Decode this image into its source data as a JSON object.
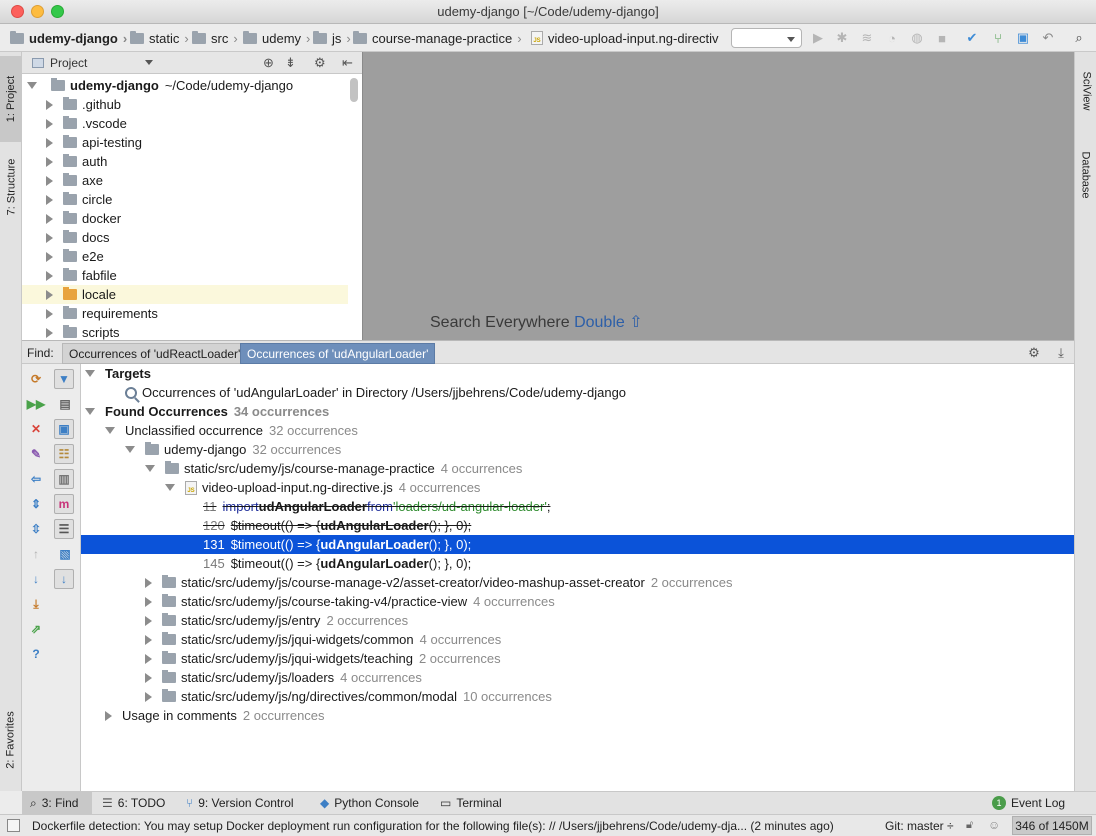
{
  "window": {
    "title": "udemy-django [~/Code/udemy-django]"
  },
  "breadcrumbs": [
    {
      "label": "udemy-django"
    },
    {
      "label": "static"
    },
    {
      "label": "src"
    },
    {
      "label": "udemy"
    },
    {
      "label": "js"
    },
    {
      "label": "course-manage-practice"
    },
    {
      "label": "video-upload-input.ng-directiv"
    }
  ],
  "left_strip": {
    "project_tab": "1: Project",
    "structure_tab": "7: Structure",
    "favorites_tab": "2: Favorites"
  },
  "right_strip": {
    "sciview_tab": "SciView",
    "database_tab": "Database"
  },
  "project_panel": {
    "header_label": "Project",
    "root": {
      "name": "udemy-django",
      "path": "~/Code/udemy-django"
    },
    "items": [
      ".github",
      ".vscode",
      "api-testing",
      "auth",
      "axe",
      "circle",
      "docker",
      "docs",
      "e2e",
      "fabfile",
      "locale",
      "requirements",
      "scripts"
    ]
  },
  "editor": {
    "hint_text": "Search Everywhere",
    "hint_key": "Double ⇧"
  },
  "find": {
    "label": "Find:",
    "tabs": [
      {
        "label": "Occurrences of 'udReactLoader'"
      },
      {
        "label": "Occurrences of 'udAngularLoader'"
      }
    ],
    "targets_label": "Targets",
    "target_text": "Occurrences of 'udAngularLoader' in Directory /Users/jjbehrens/Code/udemy-django",
    "found_label": "Found Occurrences",
    "found_count": "34 occurrences",
    "unclassified_label": "Unclassified occurrence",
    "unclassified_count": "32 occurrences",
    "project_label": "udemy-django",
    "project_count": "32 occurrences",
    "dir_practice": "static/src/udemy/js/course-manage-practice",
    "dir_practice_count": "4 occurrences",
    "file_label": "video-upload-input.ng-directive.js",
    "file_count": "4 occurrences",
    "lines": [
      {
        "num": "11",
        "pre": "import ",
        "ident": "udAngularLoader",
        "mid": " from ",
        "str": "'loaders/ud-angular-loader'",
        "post": ";"
      },
      {
        "num": "120",
        "pre": "$timeout(() => { ",
        "ident": "udAngularLoader",
        "post": "(); }, 0);"
      },
      {
        "num": "131",
        "pre": "$timeout(() => { ",
        "ident": "udAngularLoader",
        "post": "(); }, 0);"
      },
      {
        "num": "145",
        "pre": "$timeout(() => { ",
        "ident": "udAngularLoader",
        "post": "(); }, 0);"
      }
    ],
    "other_dirs": [
      {
        "path": "static/src/udemy/js/course-manage-v2/asset-creator/video-mashup-asset-creator",
        "count": "2 occurrences"
      },
      {
        "path": "static/src/udemy/js/course-taking-v4/practice-view",
        "count": "4 occurrences"
      },
      {
        "path": "static/src/udemy/js/entry",
        "count": "2 occurrences"
      },
      {
        "path": "static/src/udemy/js/jqui-widgets/common",
        "count": "4 occurrences"
      },
      {
        "path": "static/src/udemy/js/jqui-widgets/teaching",
        "count": "2 occurrences"
      },
      {
        "path": "static/src/udemy/js/loaders",
        "count": "4 occurrences"
      },
      {
        "path": "static/src/udemy/js/ng/directives/common/modal",
        "count": "10 occurrences"
      }
    ],
    "comments_label": "Usage in comments",
    "comments_count": "2 occurrences"
  },
  "bottom_tabs": [
    {
      "label": "3: Find",
      "icon": "search-icon"
    },
    {
      "label": "6: TODO",
      "icon": "todo-icon"
    },
    {
      "label": "9: Version Control",
      "icon": "vcs-icon"
    },
    {
      "label": "Python Console",
      "icon": "python-icon"
    },
    {
      "label": "Terminal",
      "icon": "terminal-icon"
    }
  ],
  "event_log": {
    "label": "Event Log",
    "badge": "1"
  },
  "status": {
    "message": "Dockerfile detection: You may setup Docker deployment run configuration for the following file(s): // /Users/jjbehrens/Code/udemy-dja... (2 minutes ago)",
    "git": "Git: master ÷",
    "memory": "346 of 1450M"
  },
  "colors": {
    "selection": "#0b53d9",
    "active_tab": "#6e8fbb",
    "highlight_row": "#fbf8dc"
  }
}
